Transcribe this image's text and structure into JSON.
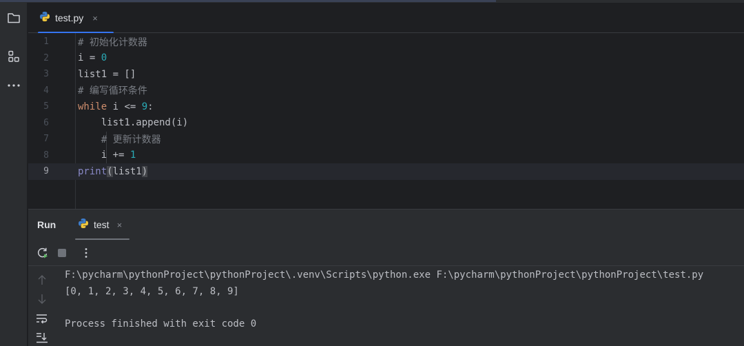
{
  "editor": {
    "tab": {
      "label": "test.py",
      "close_label": "×",
      "icon": "python-file-icon"
    },
    "lines": [
      {
        "number": "1",
        "tokens": [
          {
            "t": "comment",
            "text": "# 初始化计数器"
          }
        ]
      },
      {
        "number": "2",
        "tokens": [
          {
            "t": "plain",
            "text": "i = "
          },
          {
            "t": "number",
            "text": "0"
          }
        ]
      },
      {
        "number": "3",
        "tokens": [
          {
            "t": "plain",
            "text": "list1 = []"
          }
        ]
      },
      {
        "number": "4",
        "tokens": [
          {
            "t": "comment",
            "text": "# 编写循环条件"
          }
        ]
      },
      {
        "number": "5",
        "tokens": [
          {
            "t": "keyword",
            "text": "while"
          },
          {
            "t": "plain",
            "text": " i <= "
          },
          {
            "t": "number",
            "text": "9"
          },
          {
            "t": "plain",
            "text": ":"
          }
        ]
      },
      {
        "number": "6",
        "tokens": [
          {
            "t": "plain",
            "text": "    list1.append(i)"
          }
        ]
      },
      {
        "number": "7",
        "tokens": [
          {
            "t": "comment",
            "text": "    # 更新计数器"
          }
        ]
      },
      {
        "number": "8",
        "tokens": [
          {
            "t": "plain",
            "text": "    i += "
          },
          {
            "t": "number",
            "text": "1"
          }
        ]
      },
      {
        "number": "9",
        "tokens": [
          {
            "t": "builtin",
            "text": "print"
          },
          {
            "t": "paren",
            "text": "("
          },
          {
            "t": "plain",
            "text": "list1"
          },
          {
            "t": "paren",
            "text": ")"
          }
        ]
      }
    ],
    "current_line": "9"
  },
  "toolstrip": {
    "items": [
      "folder-icon",
      "structure-icon",
      "more-icon"
    ]
  },
  "run": {
    "title": "Run",
    "tab": {
      "label": "test",
      "close_label": "×",
      "icon": "python-file-icon"
    },
    "toolbar": [
      "rerun-icon",
      "stop-icon",
      "more-vertical-icon"
    ],
    "side_tools": [
      "scroll-up-icon",
      "scroll-down-icon",
      "soft-wrap-icon",
      "scroll-to-end-icon"
    ],
    "console": [
      "F:\\pycharm\\pythonProject\\pythonProject\\.venv\\Scripts\\python.exe F:\\pycharm\\pythonProject\\pythonProject\\test.py",
      "[0, 1, 2, 3, 4, 5, 6, 7, 8, 9]",
      "",
      "Process finished with exit code 0"
    ]
  },
  "colors": {
    "background": "#1e1f22",
    "panel": "#2b2d30",
    "accent": "#3574f0",
    "keyword": "#cf8e6d",
    "number": "#2aacb8",
    "comment": "#7a7e85",
    "builtin": "#8888c6"
  }
}
